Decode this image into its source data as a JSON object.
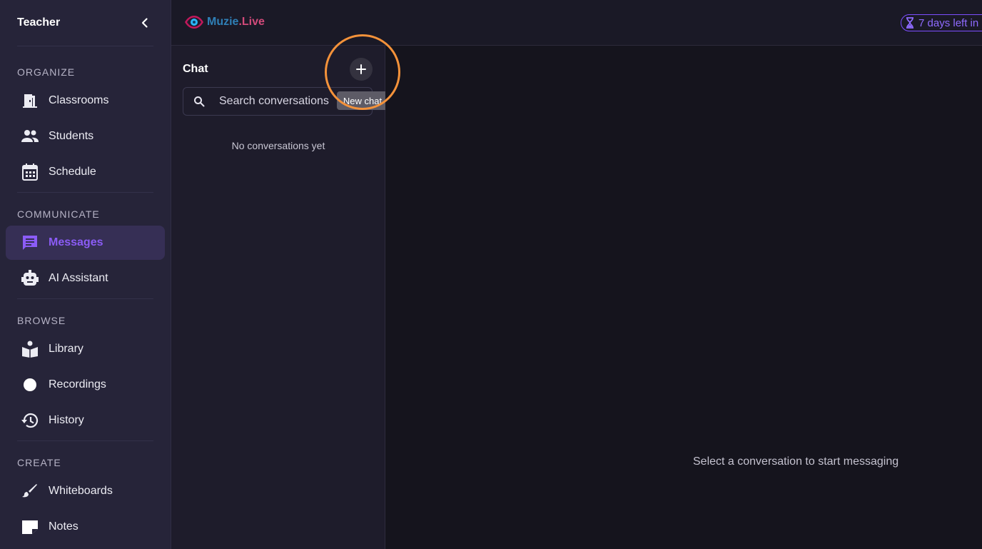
{
  "sidebar": {
    "title": "Teacher",
    "sections": [
      {
        "label": "ORGANIZE",
        "items": [
          {
            "label": "Classrooms",
            "icon": "door-icon"
          },
          {
            "label": "Students",
            "icon": "people-icon"
          },
          {
            "label": "Schedule",
            "icon": "calendar-icon"
          }
        ]
      },
      {
        "label": "COMMUNICATE",
        "items": [
          {
            "label": "Messages",
            "icon": "chat-bubble-icon",
            "active": true
          },
          {
            "label": "AI Assistant",
            "icon": "robot-icon"
          }
        ]
      },
      {
        "label": "BROWSE",
        "items": [
          {
            "label": "Library",
            "icon": "book-reader-icon"
          },
          {
            "label": "Recordings",
            "icon": "record-dot-icon"
          },
          {
            "label": "History",
            "icon": "history-icon"
          }
        ]
      },
      {
        "label": "CREATE",
        "items": [
          {
            "label": "Whiteboards",
            "icon": "brush-icon"
          },
          {
            "label": "Notes",
            "icon": "note-icon"
          }
        ]
      }
    ]
  },
  "topbar": {
    "brand_name": "Muzie",
    "brand_suffix": ".Live",
    "trial_text": "7 days left in",
    "trial_icon": "hourglass-icon"
  },
  "chat": {
    "title": "Chat",
    "new_chat_tooltip": "New chat",
    "search_placeholder": "Search conversations",
    "empty_text": "No conversations yet"
  },
  "main": {
    "empty_text": "Select a conversation to start messaging"
  },
  "colors": {
    "accent": "#8b5cf6",
    "highlight": "#f4923a",
    "sidebar_bg": "#262439"
  }
}
